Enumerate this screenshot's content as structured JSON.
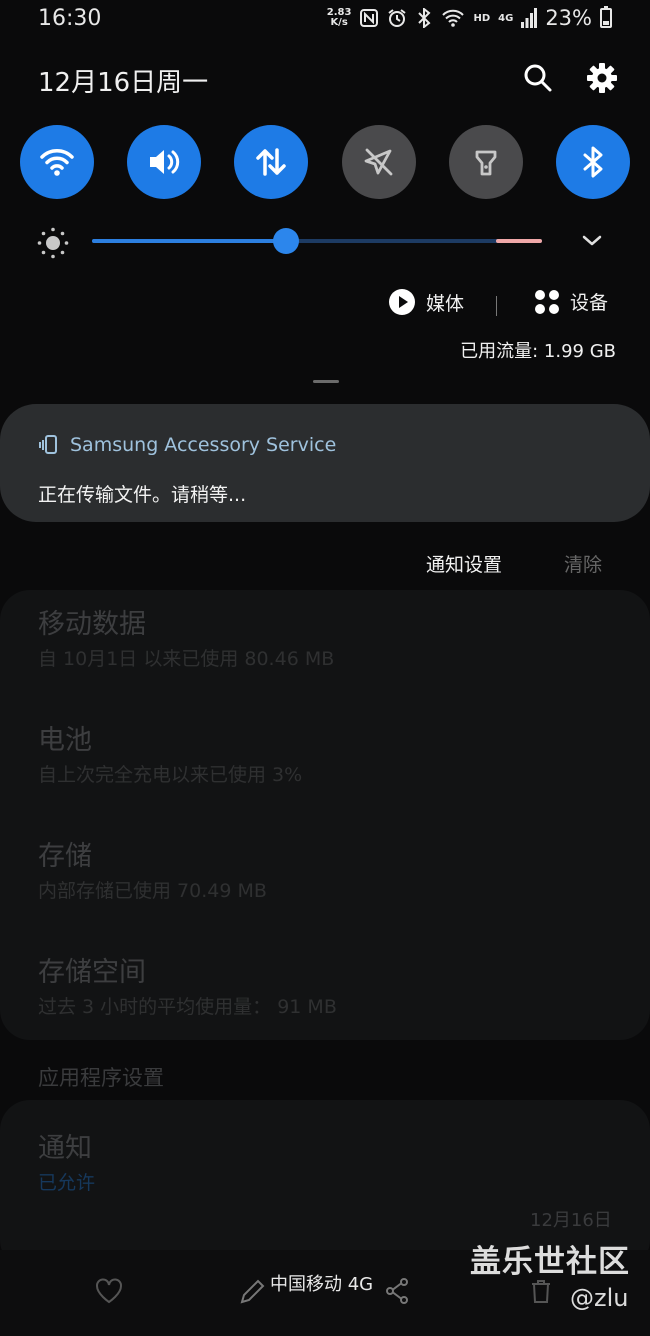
{
  "status_bar": {
    "time": "16:30",
    "net_speed_value": "2.83",
    "net_speed_unit": "K/s",
    "network_hd": "HD",
    "network_gen": "4G",
    "battery": "23%"
  },
  "header": {
    "date": "12月16日周一"
  },
  "quick_toggles": [
    {
      "icon": "wifi-icon",
      "state": "on"
    },
    {
      "icon": "sound-icon",
      "state": "on"
    },
    {
      "icon": "mobile-data-icon",
      "state": "on"
    },
    {
      "icon": "airplane-mode-icon",
      "state": "off"
    },
    {
      "icon": "flashlight-icon",
      "state": "off"
    },
    {
      "icon": "bluetooth-icon",
      "state": "on"
    }
  ],
  "brightness": {
    "level_fraction": 0.43
  },
  "media": {
    "media_label": "媒体",
    "devices_label": "设备",
    "data_usage": "已用流量: 1.99 GB"
  },
  "notification": {
    "app_name": "Samsung Accessory Service",
    "body": "正在传输文件。请稍等..."
  },
  "notification_actions": {
    "settings": "通知设置",
    "clear": "清除"
  },
  "background": {
    "items": [
      {
        "title": "移动数据",
        "subtitle": "自 10月1日 以来已使用 80.46 MB"
      },
      {
        "title": "电池",
        "subtitle": "自上次完全充电以来已使用 3%"
      },
      {
        "title": "存储",
        "subtitle": "内部存储已使用 70.49 MB"
      },
      {
        "title": "存储空间",
        "subtitle": "过去 3 小时的平均使用量： 91 MB"
      }
    ],
    "section_header": "应用程序设置",
    "notify_title": "通知",
    "notify_sub": "已允许",
    "date": "12月16日"
  },
  "bottom_bar": {
    "carrier": "中国移动 4G"
  },
  "watermark": {
    "site": "盖乐世社区",
    "user": "@zlu"
  },
  "colors": {
    "accent": "#1e7be6",
    "toggle_off": "#4a4a4c",
    "card": "#2b2d2f"
  }
}
